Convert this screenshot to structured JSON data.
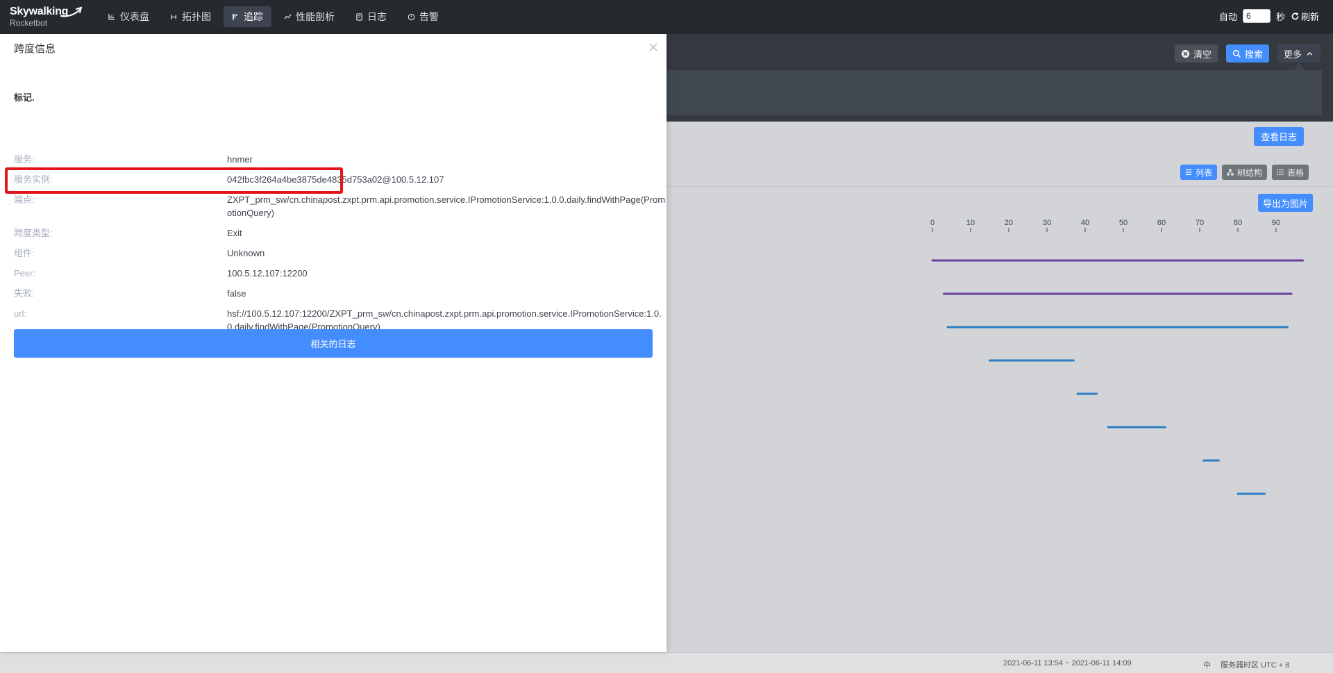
{
  "topbar": {
    "logo_main": "Skywalking",
    "logo_sub": "Rocketbot",
    "nav": [
      {
        "label": "仪表盘",
        "icon": "dashboard-icon"
      },
      {
        "label": "拓扑图",
        "icon": "topology-icon"
      },
      {
        "label": "追踪",
        "icon": "trace-icon",
        "active": true
      },
      {
        "label": "性能剖析",
        "icon": "profile-icon"
      },
      {
        "label": "日志",
        "icon": "log-icon"
      },
      {
        "label": "告警",
        "icon": "alarm-icon"
      }
    ],
    "auto_label": "自动",
    "interval_value": "6",
    "seconds_label": "秒",
    "refresh_label": "刷新"
  },
  "trace_panel": {
    "clear_label": "清空",
    "search_label": "搜索",
    "more_label": "更多",
    "view_logs_label": "查看日志",
    "view_list_label": "列表",
    "view_tree_label": "树结构",
    "view_table_label": "表格",
    "export_label": "导出为图片",
    "axis_ticks": [
      "0",
      "10",
      "20",
      "30",
      "40",
      "50",
      "60",
      "70",
      "80",
      "90"
    ],
    "spans": [
      {
        "start": 0,
        "end": 97,
        "color": "#6a3d9a"
      },
      {
        "start": 3,
        "end": 94,
        "color": "#6a3d9a"
      },
      {
        "start": 4,
        "end": 93,
        "color": "#2f7ec3"
      },
      {
        "start": 15,
        "end": 37,
        "color": "#2f7ec3"
      },
      {
        "start": 38,
        "end": 43,
        "color": "#2f7ec3"
      },
      {
        "start": 46,
        "end": 61,
        "color": "#2f7ec3"
      },
      {
        "start": 71,
        "end": 75,
        "color": "#2f7ec3"
      },
      {
        "start": 80,
        "end": 87,
        "color": "#2f7ec3"
      }
    ]
  },
  "drawer": {
    "title": "跨度信息",
    "section_title": "标记.",
    "rows": [
      {
        "key": "服务:",
        "value": "hnmer"
      },
      {
        "key": "服务实例:",
        "value": "042fbc3f264a4be3875de4835d753a02@100.5.12.107"
      },
      {
        "key": "端点:",
        "value": "ZXPT_prm_sw/cn.chinapost.zxpt.prm.api.promotion.service.IPromotionService:1.0.0.daily.findWithPage(PromotionQuery)"
      },
      {
        "key": "跨度类型:",
        "value": "Exit"
      },
      {
        "key": "组件:",
        "value": "Unknown"
      },
      {
        "key": "Peer:",
        "value": "100.5.12.107:12200"
      },
      {
        "key": "失败:",
        "value": "false"
      },
      {
        "key": "url:",
        "value": "hsf://100.5.12.107:12200/ZXPT_prm_sw/cn.chinapost.zxpt.prm.api.promotion.service.IPromotionService:1.0.0.daily.findWithPage(PromotionQuery)"
      }
    ],
    "related_logs_label": "相关的日志"
  },
  "footer": {
    "time_range": "2021-06-11 13:54 ~ 2021-06-11 14:09",
    "lang": "中",
    "timezone": "服务器时区 UTC + 8"
  }
}
